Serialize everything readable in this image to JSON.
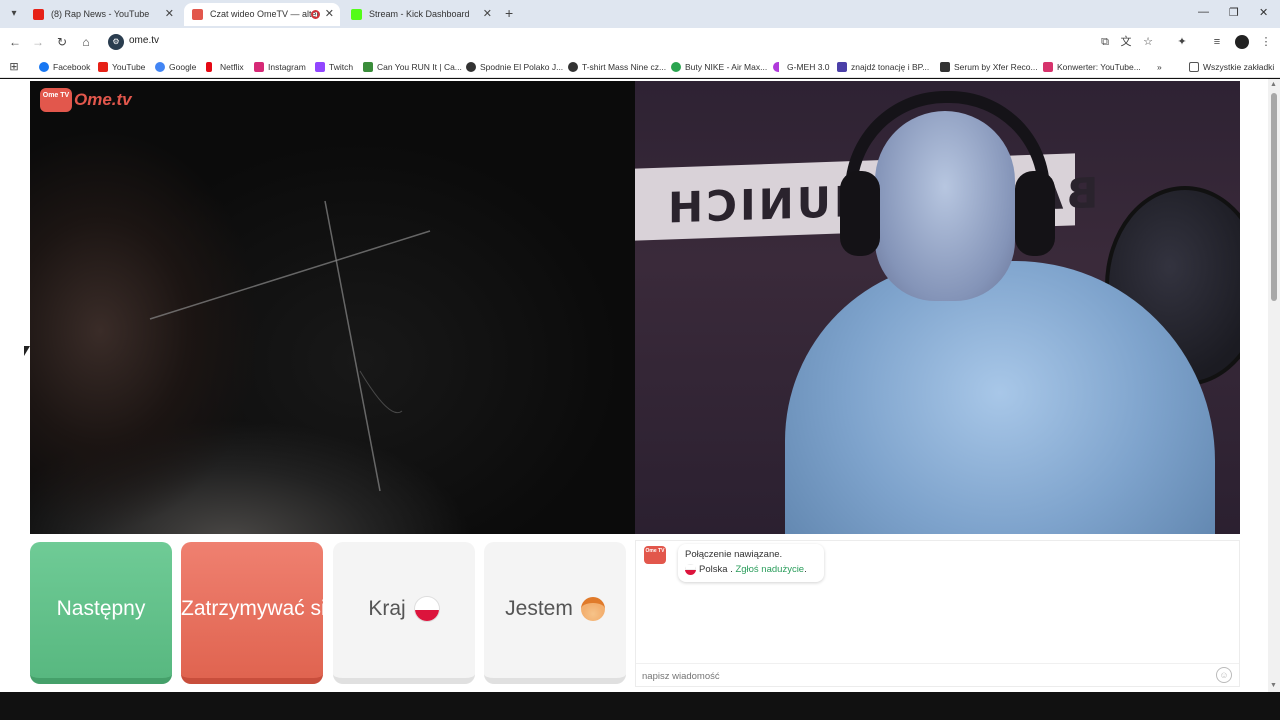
{
  "browser": {
    "tabs": [
      {
        "title": "(8) Rap News - YouTube",
        "favicon_color": "#e62117",
        "active": false
      },
      {
        "title": "Czat wideo OmeTV — alter",
        "favicon_color": "#e2574c",
        "active": true
      },
      {
        "title": "Stream - Kick Dashboard",
        "favicon_color": "#53fc18",
        "active": false
      }
    ],
    "new_tab_label": "+",
    "url": "ome.tv",
    "bookmarks": [
      {
        "label": "Facebook",
        "color": "#1877f2"
      },
      {
        "label": "YouTube",
        "color": "#e62117"
      },
      {
        "label": "Google",
        "color": "#4285f4"
      },
      {
        "label": "Netflix",
        "color": "#e50914"
      },
      {
        "label": "Instagram",
        "color": "#d62976"
      },
      {
        "label": "Twitch",
        "color": "#9146ff"
      },
      {
        "label": "Can You RUN It | Ca...",
        "color": "#3a8d3a"
      },
      {
        "label": "Spodnie El Polako J...",
        "color": "#333333"
      },
      {
        "label": "T-shirt Mass Nine cz...",
        "color": "#333333"
      },
      {
        "label": "Buty NIKE - Air Max...",
        "color": "#2aa44f"
      },
      {
        "label": "G-MEH 3.0",
        "color": "#b03adb"
      },
      {
        "label": "znajdź tonację i BP...",
        "color": "#4b3fa8"
      },
      {
        "label": "Serum by Xfer Reco...",
        "color": "#333333"
      },
      {
        "label": "Konwerter: YouTube...",
        "color": "#d6336c"
      }
    ],
    "bookmarks_overflow": "»",
    "all_bookmarks": "Wszystkie zakładki"
  },
  "app": {
    "logo_badge": "Ome TV",
    "logo_text": "Ome.tv",
    "brand_color": "#e2574c",
    "remote_banner_text": "BAYERN MUNICH",
    "controls": {
      "next_label": "Następny",
      "stop_label": "Zatrzymywać się",
      "country_label": "Kraj",
      "gender_label": "Jestem"
    },
    "chat": {
      "status": "Połączenie nawiązane.",
      "country": "Polska",
      "separator": ".",
      "report_link": "Zgłoś nadużycie",
      "report_end": ".",
      "input_placeholder": "napisz wiadomość"
    }
  }
}
